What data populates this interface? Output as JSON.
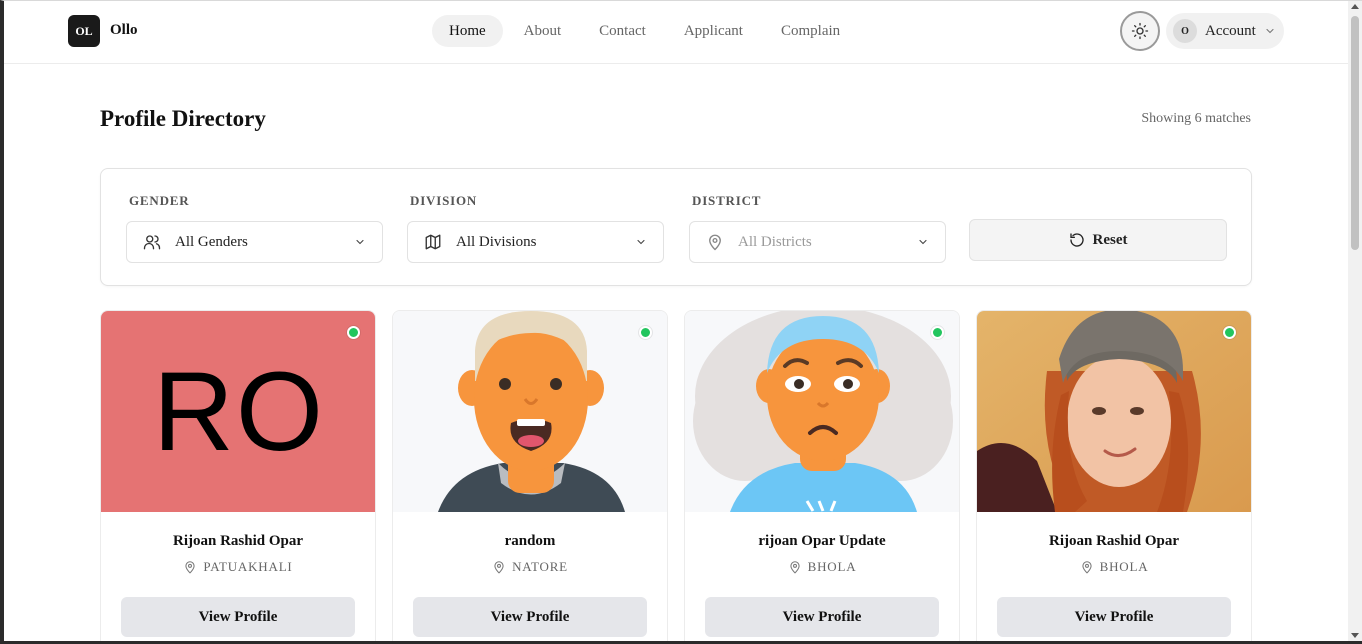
{
  "brand": {
    "logo_initials": "OL",
    "name": "Ollo"
  },
  "nav": {
    "items": [
      {
        "label": "Home",
        "active": true
      },
      {
        "label": "About",
        "active": false
      },
      {
        "label": "Contact",
        "active": false
      },
      {
        "label": "Applicant",
        "active": false
      },
      {
        "label": "Complain",
        "active": false
      }
    ]
  },
  "header": {
    "theme_icon": "sun-icon",
    "account": {
      "avatar_initial": "O",
      "label": "Account"
    }
  },
  "page": {
    "title": "Profile Directory",
    "match_count": "Showing 6 matches"
  },
  "filters": {
    "gender": {
      "label": "GENDER",
      "value": "All Genders",
      "icon": "users-icon"
    },
    "division": {
      "label": "DIVISION",
      "value": "All Divisions",
      "icon": "map-icon"
    },
    "district": {
      "label": "DISTRICT",
      "value": "All Districts",
      "icon": "map-pin-icon"
    },
    "reset_label": "Reset"
  },
  "cards": [
    {
      "name": "Rijoan Rashid Opar",
      "location": "PATUAKHALI",
      "button": "View Profile",
      "avatar_type": "initials",
      "initials": "RO",
      "online": true
    },
    {
      "name": "random",
      "location": "NATORE",
      "button": "View Profile",
      "avatar_type": "illustration",
      "online": true
    },
    {
      "name": "rijoan Opar Update",
      "location": "BHOLA",
      "button": "View Profile",
      "avatar_type": "illustration",
      "online": true
    },
    {
      "name": "Rijoan Rashid Opar",
      "location": "BHOLA",
      "button": "View Profile",
      "avatar_type": "photo",
      "online": true
    }
  ],
  "colors": {
    "online": "#22c55e",
    "initials_bg": "#e57373",
    "button_bg": "#e5e6ea"
  }
}
